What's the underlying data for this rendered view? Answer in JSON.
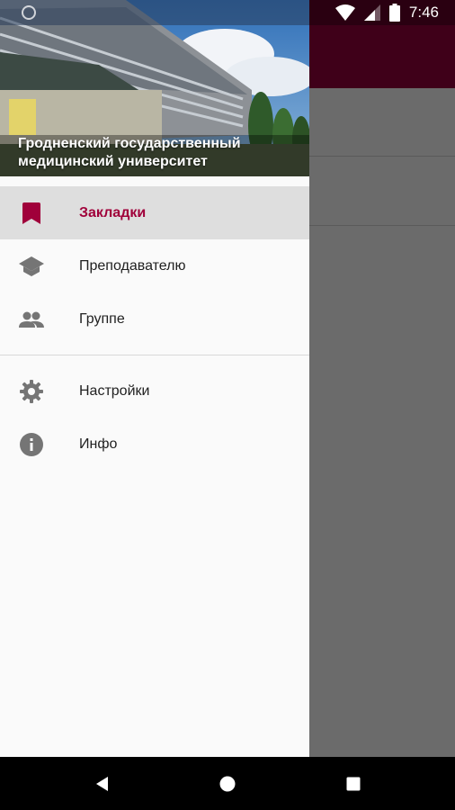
{
  "status_bar": {
    "time": "7:46",
    "icons": [
      "loading-icon",
      "wifi-icon",
      "signal-icon",
      "battery-icon"
    ]
  },
  "drawer": {
    "header": {
      "title": "Гродненский государственный медицинский университет"
    },
    "items": [
      {
        "label": "Закладки",
        "icon": "bookmark-icon",
        "active": true
      },
      {
        "label": "Преподавателю",
        "icon": "graduation-cap-icon",
        "active": false
      },
      {
        "label": "Группе",
        "icon": "group-icon",
        "active": false
      },
      {
        "label": "Настройки",
        "icon": "gear-icon",
        "active": false
      },
      {
        "label": "Инфо",
        "icon": "info-icon",
        "active": false
      }
    ]
  },
  "colors": {
    "accent": "#a0003a",
    "toolbar": "#3f0019",
    "icon": "#757575"
  },
  "nav_bar": {
    "buttons": [
      "back-icon",
      "home-icon",
      "recents-icon"
    ]
  }
}
